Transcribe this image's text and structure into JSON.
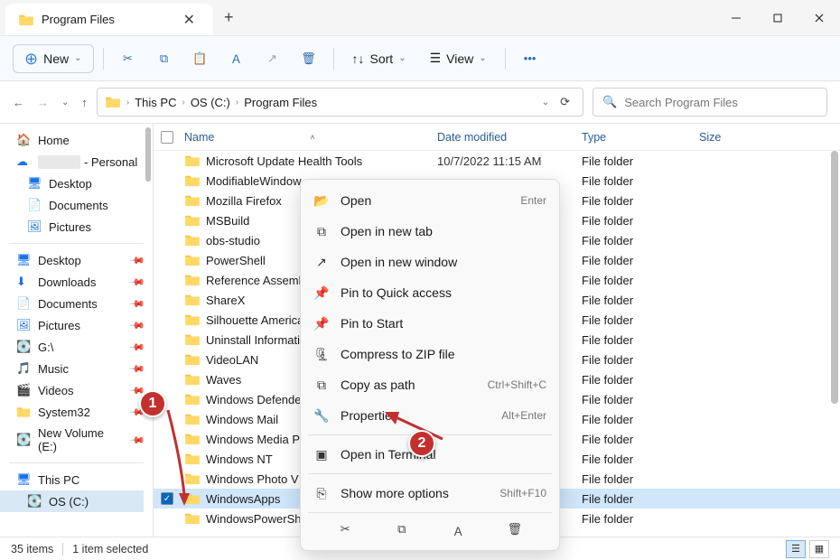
{
  "window": {
    "tab_title": "Program Files"
  },
  "toolbar": {
    "new_label": "New",
    "sort_label": "Sort",
    "view_label": "View"
  },
  "breadcrumb": {
    "items": [
      "This PC",
      "OS (C:)",
      "Program Files"
    ]
  },
  "search": {
    "placeholder": "Search Program Files"
  },
  "sidebar": {
    "home": "Home",
    "personal_suffix": "- Personal",
    "desktop": "Desktop",
    "documents": "Documents",
    "pictures": "Pictures",
    "quick": {
      "desktop": "Desktop",
      "downloads": "Downloads",
      "documents": "Documents",
      "pictures": "Pictures",
      "g_drive": "G:\\",
      "music": "Music",
      "videos": "Videos",
      "system32": "System32",
      "new_volume": "New Volume (E:)"
    },
    "this_pc": "This PC",
    "os_c": "OS (C:)"
  },
  "columns": {
    "name": "Name",
    "date": "Date modified",
    "type": "Type",
    "size": "Size"
  },
  "rows": [
    {
      "name": "Microsoft Update Health Tools",
      "date": "10/7/2022 11:15 AM",
      "type": "File folder",
      "selected": false
    },
    {
      "name": "ModifiableWindow",
      "date": "",
      "type": "File folder",
      "selected": false
    },
    {
      "name": "Mozilla Firefox",
      "date": "",
      "type": "File folder",
      "selected": false
    },
    {
      "name": "MSBuild",
      "date": "",
      "type": "File folder",
      "selected": false
    },
    {
      "name": "obs-studio",
      "date": "",
      "type": "File folder",
      "selected": false
    },
    {
      "name": "PowerShell",
      "date": "",
      "type": "File folder",
      "selected": false
    },
    {
      "name": "Reference Assemb",
      "date": "",
      "type": "File folder",
      "selected": false
    },
    {
      "name": "ShareX",
      "date": "",
      "type": "File folder",
      "selected": false
    },
    {
      "name": "Silhouette America",
      "date": "",
      "type": "File folder",
      "selected": false
    },
    {
      "name": "Uninstall Informati",
      "date": "",
      "type": "File folder",
      "selected": false
    },
    {
      "name": "VideoLAN",
      "date": "",
      "type": "File folder",
      "selected": false
    },
    {
      "name": "Waves",
      "date": "",
      "type": "File folder",
      "selected": false
    },
    {
      "name": "Windows Defender",
      "date": "",
      "type": "File folder",
      "selected": false
    },
    {
      "name": "Windows Mail",
      "date": "",
      "type": "File folder",
      "selected": false
    },
    {
      "name": "Windows Media P",
      "date": "",
      "type": "File folder",
      "selected": false
    },
    {
      "name": "Windows NT",
      "date": "",
      "type": "File folder",
      "selected": false
    },
    {
      "name": "Windows Photo V",
      "date": "",
      "type": "File folder",
      "selected": false
    },
    {
      "name": "WindowsApps",
      "date": "",
      "type": "File folder",
      "selected": true
    },
    {
      "name": "WindowsPowerSh",
      "date": "",
      "type": "File folder",
      "selected": false
    }
  ],
  "context_menu": {
    "open": "Open",
    "open_accel": "Enter",
    "open_new_tab": "Open in new tab",
    "open_new_window": "Open in new window",
    "pin_quick": "Pin to Quick access",
    "pin_start": "Pin to Start",
    "compress": "Compress to ZIP file",
    "copy_path": "Copy as path",
    "copy_path_accel": "Ctrl+Shift+C",
    "properties": "Properties",
    "properties_accel": "Alt+Enter",
    "open_terminal": "Open in Terminal",
    "show_more": "Show more options",
    "show_more_accel": "Shift+F10"
  },
  "status": {
    "items": "35 items",
    "selected": "1 item selected"
  },
  "annotations": {
    "one": "1",
    "two": "2"
  }
}
